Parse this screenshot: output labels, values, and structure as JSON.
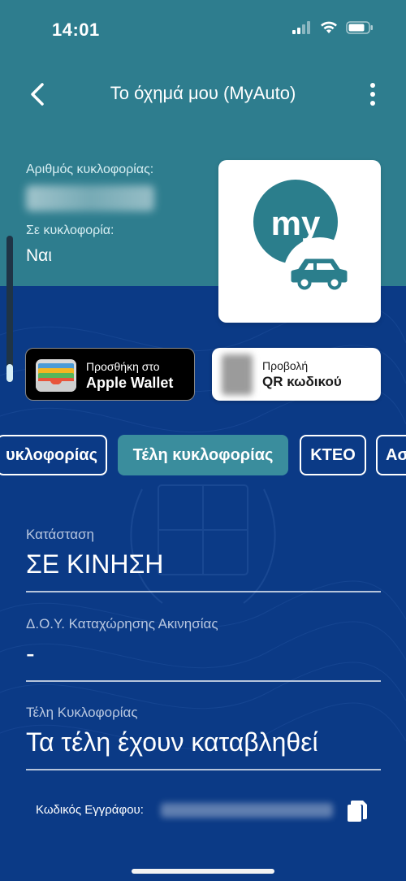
{
  "status_bar": {
    "time": "14:01"
  },
  "header": {
    "title": "Το όχημά μου (MyAuto)"
  },
  "vehicle": {
    "plate_label": "Αριθμός κυκλοφορίας:",
    "in_circulation_label": "Σε κυκλοφορία:",
    "in_circulation_value": "Ναι"
  },
  "logo": {
    "text": "my"
  },
  "actions": {
    "wallet_line1": "Προσθήκη στο",
    "wallet_line2": "Apple Wallet",
    "qr_line1": "Προβολή",
    "qr_line2": "QR κωδικού"
  },
  "tabs": [
    {
      "label": "υκλοφορίας",
      "active": false
    },
    {
      "label": "Τέλη κυκλοφορίας",
      "active": true
    },
    {
      "label": "ΚΤΕΟ",
      "active": false
    },
    {
      "label": "Ασ",
      "active": false
    }
  ],
  "sections": [
    {
      "label": "Κατάσταση",
      "value": "ΣΕ ΚΙΝΗΣΗ"
    },
    {
      "label": "Δ.Ο.Υ. Καταχώρησης Ακινησίας",
      "value": "-"
    },
    {
      "label": "Τέλη Κυκλοφορίας",
      "value": "Τα τέλη έχουν καταβληθεί"
    }
  ],
  "document": {
    "code_label": "Κωδικός Εγγράφου:"
  },
  "colors": {
    "header_teal": "#2e7d8e",
    "body_navy": "#0b3a86",
    "active_tab": "#3a8d9d",
    "logo_teal": "#2b7e8c"
  }
}
